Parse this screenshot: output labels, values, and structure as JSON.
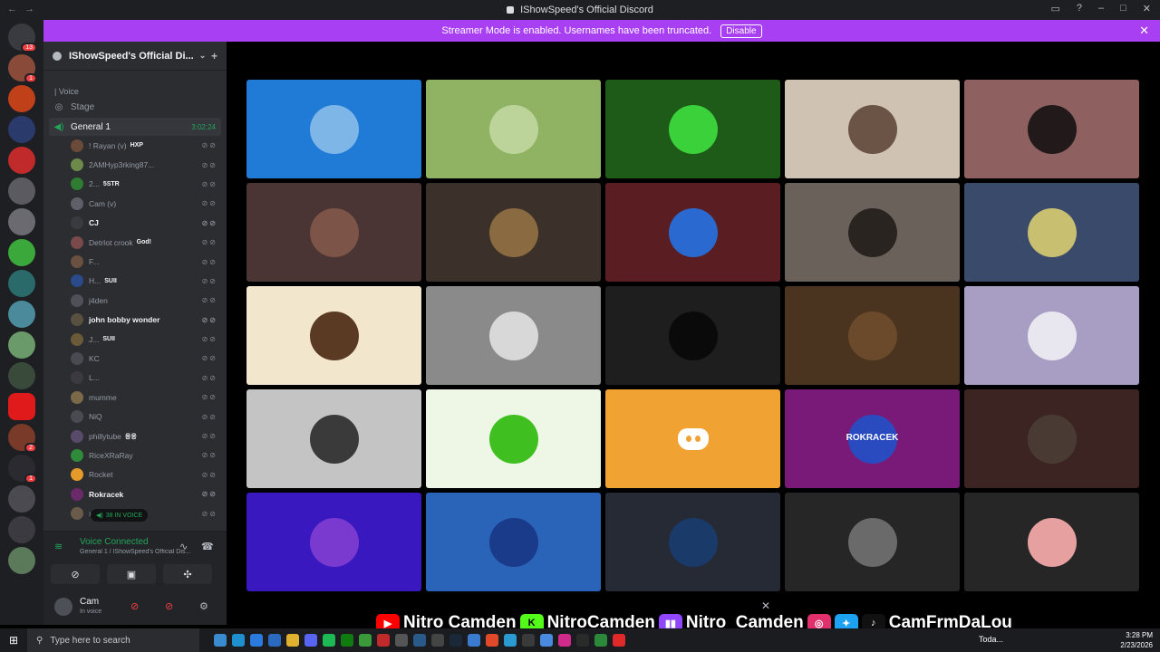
{
  "window": {
    "title": "IShowSpeed's Official Discord",
    "nav_back": "←",
    "nav_forward": "→"
  },
  "banner": {
    "text": "Streamer Mode is enabled. Usernames have been truncated.",
    "disable_label": "Disable"
  },
  "guild_badges": {
    "top": "13",
    "second": "1",
    "mid": "2",
    "lower": "1"
  },
  "server": {
    "name": "IShowSpeed's Official Di...",
    "category": "| Voice",
    "stage_label": "Stage",
    "active_channel": "General 1",
    "timer": "3:02:24"
  },
  "voice_users": [
    {
      "name": "! Rayan (v)",
      "tag": "HXP",
      "color": "#6b4a3a"
    },
    {
      "name": "2AMHyp3rking87...",
      "tag": "",
      "color": "#6e8a4a"
    },
    {
      "name": "2...",
      "tag": "5STR",
      "color": "#2e7d32"
    },
    {
      "name": "Cam (v)",
      "tag": "",
      "color": "#5d6068"
    },
    {
      "name": "CJ",
      "tag": "",
      "color": "#3a3b40"
    },
    {
      "name": "DetrIot crook",
      "tag": "God!",
      "color": "#7a4a4a"
    },
    {
      "name": "F...",
      "tag": "",
      "color": "#6a5040"
    },
    {
      "name": "H...",
      "tag": "SUII",
      "color": "#2a4a8a"
    },
    {
      "name": "j4den",
      "tag": "",
      "color": "#505058"
    },
    {
      "name": "john bobby wonder",
      "tag": "",
      "color": "#5a5040"
    },
    {
      "name": "J...",
      "tag": "SUII",
      "color": "#6a5a3a"
    },
    {
      "name": "KC",
      "tag": "",
      "color": "#4a4a52"
    },
    {
      "name": "L...",
      "tag": "",
      "color": "#3a3a40"
    },
    {
      "name": "mumme",
      "tag": "",
      "color": "#7a6a4a"
    },
    {
      "name": "NiQ",
      "tag": "",
      "color": "#4a4a52"
    },
    {
      "name": "phillytube",
      "tag": "응응",
      "color": "#5a4a6a"
    },
    {
      "name": "RiceXRaRay",
      "tag": "",
      "color": "#2e8b3a"
    },
    {
      "name": "Rocket",
      "tag": "",
      "color": "#e59a2a"
    },
    {
      "name": "Rokracek",
      "tag": "",
      "color": "#6a2a6a"
    },
    {
      "name": "xer",
      "tag": "",
      "color": "#6a5a4a"
    }
  ],
  "voice_pill": "38 IN VOICE",
  "voice_panel": {
    "title": "Voice Connected",
    "subtitle": "General 1 / IShowSpeed's Official Dis..."
  },
  "user": {
    "name": "Cam",
    "status": "In voice"
  },
  "tiles": [
    {
      "bg": "#1f7bd6",
      "face": "#7fb6e8"
    },
    {
      "bg": "#8fb363",
      "face": "#bcd49a"
    },
    {
      "bg": "#1e5a18",
      "face": "#3ad13a"
    },
    {
      "bg": "#d0c2b2",
      "face": "#6b5446"
    },
    {
      "bg": "#8e6060",
      "face": "#221a1a"
    },
    {
      "bg": "#4a3434",
      "face": "#7d5448"
    },
    {
      "bg": "#3c302a",
      "face": "#8a6a40"
    },
    {
      "bg": "#5a1e22",
      "face": "#2a6ad0"
    },
    {
      "bg": "#6a625a",
      "face": "#2a2420"
    },
    {
      "bg": "#3a4a6a",
      "face": "#c8c070"
    },
    {
      "bg": "#f2e7cc",
      "face": "#5a3a22"
    },
    {
      "bg": "#8a8a8a",
      "face": "#d8d8d8"
    },
    {
      "bg": "#1e1e1e",
      "face": "#0a0a0a"
    },
    {
      "bg": "#4a3420",
      "face": "#6a4a2a"
    },
    {
      "bg": "#a89ec4",
      "face": "#e8e6ee"
    },
    {
      "bg": "#c4c4c4",
      "face": "#3a3a3a"
    },
    {
      "bg": "#eef6e6",
      "face": "#40c020"
    },
    {
      "bg": "#f0a232",
      "face": ""
    },
    {
      "bg": "#7a1a78",
      "face": "#2a4ac0"
    },
    {
      "bg": "#3c2422",
      "face": "#4a3a34"
    },
    {
      "bg": "#3a18c0",
      "face": "#7a3ad0"
    },
    {
      "bg": "#2a64b8",
      "face": "#1a3a8a"
    },
    {
      "bg": "#262a34",
      "face": "#1a3a6a"
    },
    {
      "bg": "#262626",
      "face": "#6a6a6a"
    },
    {
      "bg": "#262626",
      "face": "#e6a0a0"
    }
  ],
  "tile_label": "ROKRACEK",
  "socials": {
    "youtube": "Nitro Camden",
    "kick": "NitroCamden",
    "twitch": "Nitro_Camden",
    "handle": "CamFrmDaLou"
  },
  "taskbar": {
    "search_placeholder": "Type here to search",
    "weather": "Toda...",
    "time": "3:28 PM",
    "date": "2/23/2026"
  }
}
